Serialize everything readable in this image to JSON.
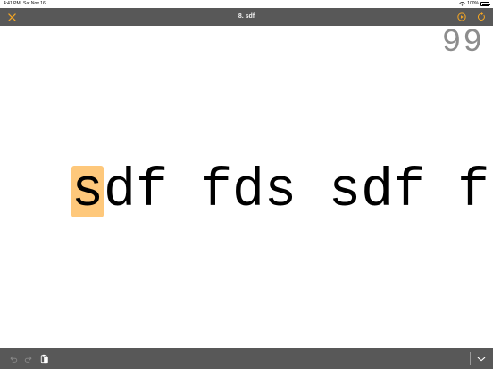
{
  "status": {
    "time": "4:41 PM",
    "date": "Sat Nov 16",
    "battery": "100%"
  },
  "navbar": {
    "title": "8. sdf"
  },
  "counter": "99",
  "typing": {
    "current": "s",
    "rest": "df fds sdf f"
  },
  "colors": {
    "accent": "#f5a623",
    "bar": "#585858",
    "highlight": "#fec87b",
    "counter": "#8d8d8d"
  },
  "icons": {
    "close": "close-icon",
    "play": "play-circle-icon",
    "restart": "restart-icon",
    "undo": "undo-icon",
    "redo": "redo-icon",
    "paste": "paste-icon",
    "keyboard_down": "chevron-down-icon"
  }
}
